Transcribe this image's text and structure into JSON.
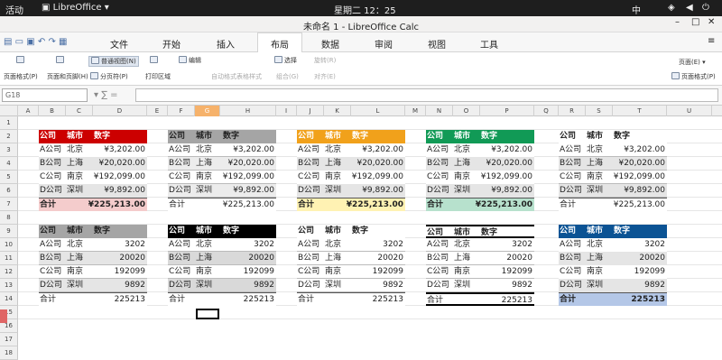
{
  "system_bar": {
    "activities": "活动",
    "app_menu": "LibreOffice",
    "clock": "星期二 12：25",
    "input_method": "中"
  },
  "window": {
    "title": "未命名 1 - LibreOffice Calc"
  },
  "menu_tabs": [
    "文件",
    "开始",
    "插入",
    "布局",
    "数据",
    "审阅",
    "视图",
    "工具"
  ],
  "active_tab_index": 3,
  "ribbon": {
    "page_style": "页面格式(P)",
    "header_footer": "页面和页脚(H)",
    "normal_view": "普通视图(N)",
    "page_break": "分页符(P)",
    "print_range": "打印区域",
    "edit": "编辑",
    "autoformat": "自动格式表格样式",
    "select": "选择",
    "rotate": "旋转(R)",
    "group": "组合(G)",
    "align": "对齐(E)",
    "page_right": "页面(E)",
    "page_style_right": "页面格式(P)"
  },
  "name_box": "G18",
  "columns": [
    "A",
    "B",
    "C",
    "D",
    "E",
    "F",
    "G",
    "H",
    "I",
    "J",
    "K",
    "L",
    "M",
    "N",
    "O",
    "P",
    "Q",
    "R",
    "S",
    "T",
    "U"
  ],
  "rows": [
    "1",
    "2",
    "3",
    "4",
    "5",
    "6",
    "7",
    "8",
    "9",
    "10",
    "11",
    "12",
    "13",
    "14",
    "15",
    "16",
    "17",
    "18"
  ],
  "headers": [
    "公司",
    "城市",
    "数字"
  ],
  "data_formatted": [
    [
      "A公司",
      "北京",
      "¥3,202.00"
    ],
    [
      "B公司",
      "上海",
      "¥20,020.00"
    ],
    [
      "C公司",
      "南京",
      "¥192,099.00"
    ],
    [
      "D公司",
      "深圳",
      "¥9,892.00"
    ]
  ],
  "total_formatted": [
    "合计",
    "¥225,213.00"
  ],
  "data_plain": [
    [
      "A公司",
      "北京",
      "3202"
    ],
    [
      "B公司",
      "上海",
      "20020"
    ],
    [
      "C公司",
      "南京",
      "192099"
    ],
    [
      "D公司",
      "深圳",
      "9892"
    ]
  ],
  "total_plain": [
    "合计",
    "225213"
  ],
  "colors": {
    "red": "#cc0000",
    "gray": "#a5a5a5",
    "orange": "#f1a11b",
    "green": "#119a56",
    "blue": "#0b5394",
    "black": "#000000"
  }
}
